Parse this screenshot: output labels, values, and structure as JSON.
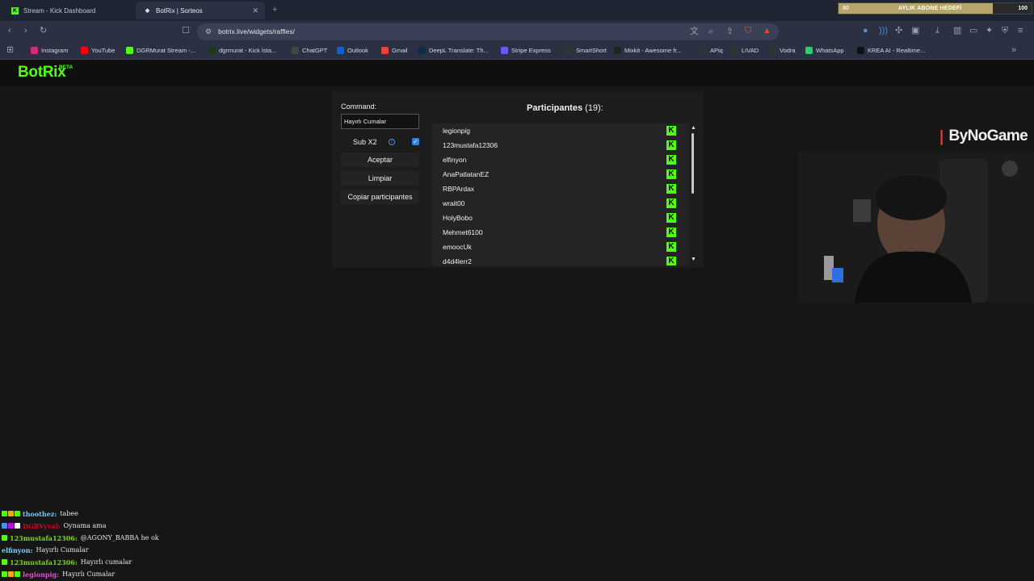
{
  "browser": {
    "tabs": [
      {
        "title": "Stream - Kick Dashboard",
        "active": false
      },
      {
        "title": "BotRix | Sorteos",
        "active": true
      }
    ],
    "url": "botrix.live/widgets/raffles/",
    "bookmarks": [
      {
        "label": "Instagram",
        "icon": "instagram-icon",
        "color": "#d62976"
      },
      {
        "label": "YouTube",
        "icon": "youtube-icon",
        "color": "#ff0000"
      },
      {
        "label": "DGRMurat Stream -...",
        "icon": "kick-icon",
        "color": "#53fc18"
      },
      {
        "label": "dgrmurat - Kick İsta...",
        "icon": "kick-icon",
        "color": "#1b3a1a"
      },
      {
        "label": "ChatGPT",
        "icon": "chatgpt-icon",
        "color": "#444444"
      },
      {
        "label": "Outlook",
        "icon": "outlook-icon",
        "color": "#0a64d6"
      },
      {
        "label": "Gmail",
        "icon": "gmail-icon",
        "color": "#ea4335"
      },
      {
        "label": "DeepL Translate: Th...",
        "icon": "deepl-icon",
        "color": "#0f2b46"
      },
      {
        "label": "Stripe Express",
        "icon": "stripe-icon",
        "color": "#635bff"
      },
      {
        "label": "SmartShort",
        "icon": "smartshort-icon",
        "color": "#333333"
      },
      {
        "label": "Mixkit - Awesome fr...",
        "icon": "mixkit-icon",
        "color": "#222222"
      },
      {
        "label": "APiq",
        "icon": "apiq-icon",
        "color": "#333333"
      },
      {
        "label": "LIVAD",
        "icon": "livad-icon",
        "color": "#333333"
      },
      {
        "label": "Vodra",
        "icon": "vodra-icon",
        "color": "#333333"
      },
      {
        "label": "WhatsApp",
        "icon": "whatsapp-icon",
        "color": "#25d366"
      },
      {
        "label": "KREA AI - Realtime...",
        "icon": "krea-icon",
        "color": "#111111"
      }
    ]
  },
  "goal": {
    "current": "80",
    "title": "AYLIK ABONE HEDEFİ",
    "target": "100",
    "progress": 0.8
  },
  "app": {
    "logo": "BotRix",
    "logo_badge": "BETA",
    "accent": "#53fc18"
  },
  "raffle": {
    "command_label": "Command:",
    "command_value": "Hayırlı Cumalar",
    "sub_label": "Sub X2",
    "sub_checked": true,
    "buttons": {
      "accept": "Aceptar",
      "clear": "Limpiar",
      "copy": "Copiar participantes"
    },
    "participants_title": "Participantes",
    "participants_count": "(19):",
    "participants": [
      "legionpig",
      "123mustafa12306",
      "elfinyon",
      "AnaPatlatanEZ",
      "RBPArdax",
      "wrait00",
      "HolyBobo",
      "Mehmet6100",
      "emoocUk",
      "d4d4lerr2"
    ]
  },
  "overlay": {
    "sponsor": "ByNoGame"
  },
  "chat": [
    {
      "user": "thoothez:",
      "text": "tabee",
      "color": "#6ec6ff",
      "badges": [
        "#53fc18",
        "#f5a623",
        "#53fc18"
      ]
    },
    {
      "user": "DGRVyval:",
      "text": "Oynama ama",
      "color": "#d0021b",
      "badges": [
        "#4a90e2",
        "#bd10e0",
        "#ffffff"
      ]
    },
    {
      "user": "123mustafa12306:",
      "text": "@AGONY_BABBA he ok",
      "color": "#7ed321",
      "badges": [
        "#53fc18"
      ]
    },
    {
      "user": "elfinyon:",
      "text": "Hayırlı Cumalar",
      "color": "#7ed3f7",
      "badges": []
    },
    {
      "user": "123mustafa12306:",
      "text": "Hayırlı cumalar",
      "color": "#7ed321",
      "badges": [
        "#53fc18"
      ]
    },
    {
      "user": "legionpig:",
      "text": "Hayırlı Cumalar",
      "color": "#e04fd0",
      "badges": [
        "#53fc18",
        "#f5a623",
        "#53fc18"
      ]
    }
  ]
}
